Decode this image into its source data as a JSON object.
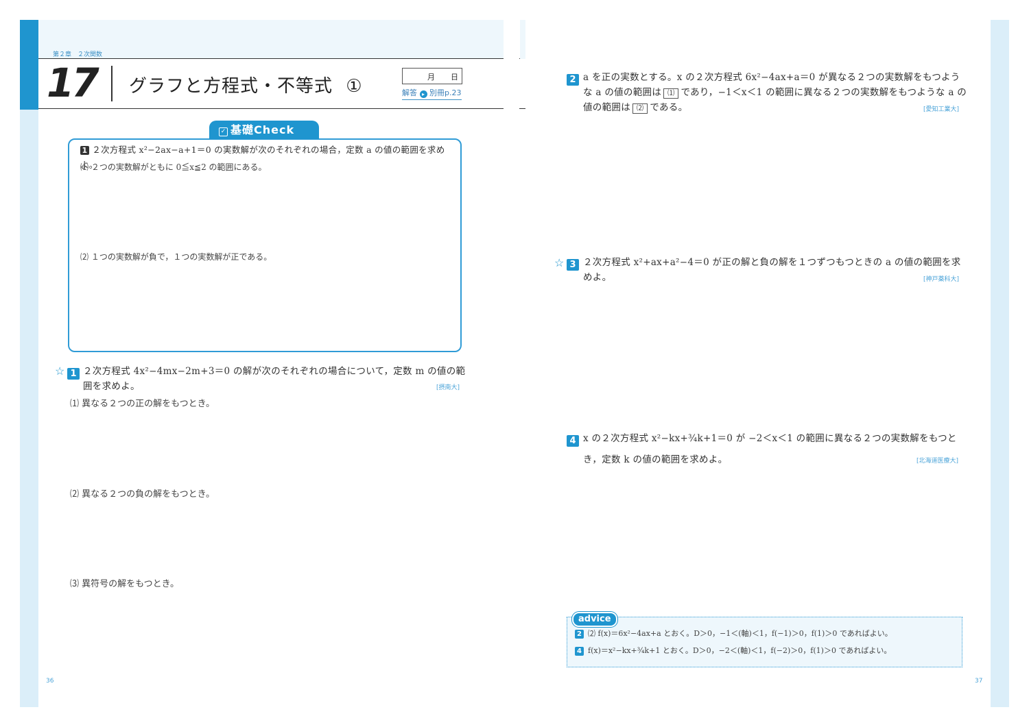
{
  "left_page": {
    "chapter_label": "第２章　２次関数",
    "lesson_number": "17",
    "lesson_title": "グラフと方程式・不等式",
    "lesson_part": "①",
    "date_month": "月",
    "date_day": "日",
    "answer_ref_prefix": "解答",
    "answer_ref": "別冊p.23",
    "check_header": "基礎Check",
    "check_problem_number": "1",
    "check_problem_text": "２次方程式 x²−2ax−a+1＝0 の実数解が次のそれぞれの場合，定数 a の値の範囲を求めよ。",
    "check_sub1": "⑴ ２つの実数解がともに 0≦x≦2 の範囲にある。",
    "check_sub2": "⑵ １つの実数解が負で，１つの実数解が正である。",
    "problem1_number": "1",
    "problem1_text_line1": "２次方程式 4x²−4mx−2m+3＝0 の解が次のそれぞれの場合について，定数 m の値の範",
    "problem1_text_line2": "囲を求めよ。",
    "problem1_source": "[摂南大]",
    "problem1_sub1": "⑴ 異なる２つの正の解をもつとき。",
    "problem1_sub2": "⑵ 異なる２つの負の解をもつとき。",
    "problem1_sub3": "⑶ 異符号の解をもつとき。",
    "page_number": "36"
  },
  "right_page": {
    "problem2_number": "2",
    "problem2_line1": "a を正の実数とする。x の２次方程式 6x²−4ax+a＝0 が異なる２つの実数解をもつよう",
    "problem2_line2a": "な a の値の範囲は",
    "problem2_blank1": "⑴",
    "problem2_line2b": "であり，−1＜x＜1 の範囲に異なる２つの実数解をもつような a の",
    "problem2_line3a": "値の範囲は",
    "problem2_blank2": "⑵",
    "problem2_line3b": "である。",
    "problem2_source": "[愛知工業大]",
    "problem3_number": "3",
    "problem3_line1": "２次方程式 x²+ax+a²−4＝0 が正の解と負の解を１つずつもつときの a の値の範囲を求",
    "problem3_line2": "めよ。",
    "problem3_source": "[神戸薬科大]",
    "problem4_number": "4",
    "problem4_line1": "x の２次方程式 x²−kx+¾k+1＝0 が −2＜x＜1 の範囲に異なる２つの実数解をもつと",
    "problem4_line2": "き，定数 k の値の範囲を求めよ。",
    "problem4_source": "[北海道医療大]",
    "advice_label": "advice",
    "advice1_number": "2",
    "advice1_text": "⑵ f(x)＝6x²−4ax+a とおく。D＞0，−1＜(軸)＜1，f(−1)＞0，f(1)＞0 であればよい。",
    "advice2_number": "4",
    "advice2_text": "f(x)＝x²−kx+¾k+1 とおく。D＞0，−2＜(軸)＜1，f(−2)＞0，f(1)＞0 であればよい。",
    "page_number": "37"
  },
  "colors": {
    "accent": "#1f95cf",
    "light_blue": "#dbeef9",
    "check_border": "#2f9bd6"
  }
}
